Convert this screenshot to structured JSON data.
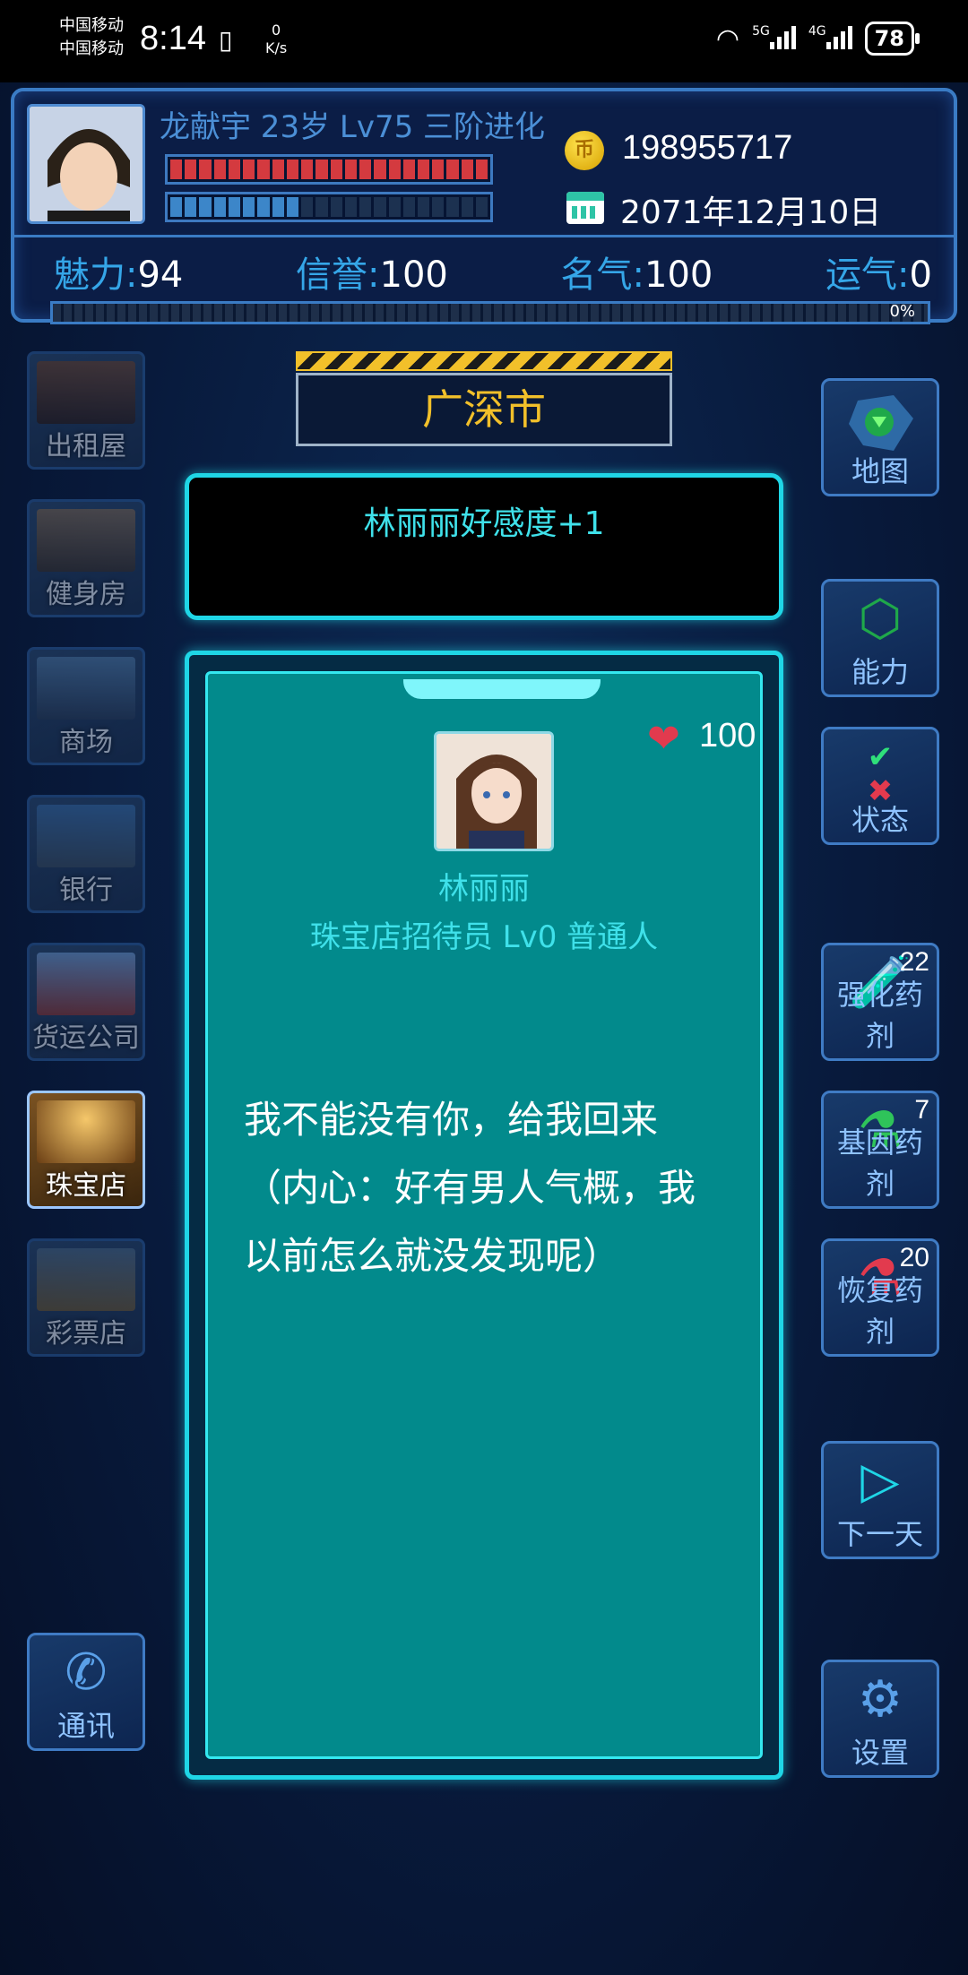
{
  "status_bar": {
    "carrier_1": "中国移动",
    "carrier_2": "中国移动",
    "time": "8:14",
    "speed_value": "0",
    "speed_unit": "K/s",
    "net_5g": "5G",
    "net_4g": "4G",
    "battery": "78"
  },
  "player": {
    "info": "龙献宇 23岁 Lv75 三阶进化",
    "coins": "198955717",
    "date": "2071年12月10日",
    "hp_fraction": 1.0,
    "energy_fraction": 0.4,
    "exp_percent": "0%"
  },
  "stats": [
    {
      "label": "魅力",
      "value": "94"
    },
    {
      "label": "信誉",
      "value": "100"
    },
    {
      "label": "名气",
      "value": "100"
    },
    {
      "label": "运气",
      "value": "0"
    }
  ],
  "left_nav": [
    {
      "label": "出租屋"
    },
    {
      "label": "健身房"
    },
    {
      "label": "商场"
    },
    {
      "label": "银行"
    },
    {
      "label": "货运公司"
    },
    {
      "label": "珠宝店"
    },
    {
      "label": "彩票店"
    }
  ],
  "right_nav": {
    "map": "地图",
    "ability": "能力",
    "status": "状态",
    "enhance_potion": {
      "label": "强化药剂",
      "count": "22"
    },
    "gene_potion": {
      "label": "基因药剂",
      "count": "7"
    },
    "recovery_potion": {
      "label": "恢复药剂",
      "count": "20"
    },
    "next_day": "下一天",
    "settings": "设置"
  },
  "contact": "通讯",
  "city": "广深市",
  "message": "林丽丽好感度+1",
  "npc": {
    "affection": "100",
    "name": "林丽丽",
    "title": "珠宝店招待员 Lv0 普通人",
    "dialog": "我不能没有你，给我回来（内心：好有男人气概，我以前怎么就没发现呢）"
  },
  "colors": {
    "accent_cyan": "#1fd6e6",
    "card_teal": "#028a8c",
    "hp_red": "#d43a3f",
    "city_gold": "#f2c02a"
  }
}
